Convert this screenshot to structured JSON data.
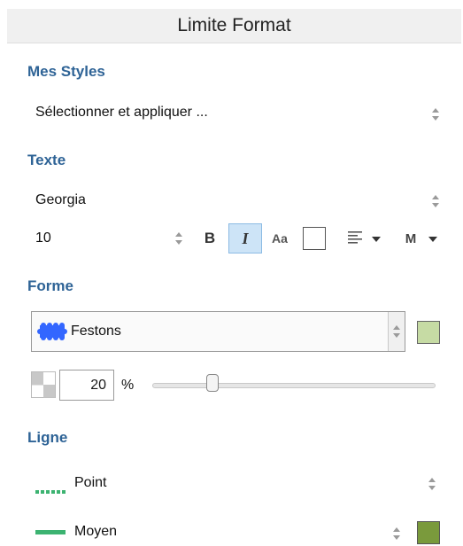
{
  "panel": {
    "title": "Limite Format"
  },
  "styles": {
    "heading": "Mes Styles",
    "select_label": "Sélectionner et appliquer ..."
  },
  "text": {
    "heading": "Texte",
    "font": "Georgia",
    "size": "10",
    "bold_label": "B",
    "italic_label": "I",
    "case_label": "Aa",
    "valign_label": "M"
  },
  "shape": {
    "heading": "Forme",
    "selected": "Festons",
    "fill_color": "#c6dba4",
    "transparency_value": "20",
    "transparency_unit": "%",
    "transparency_fraction": 0.2
  },
  "line": {
    "heading": "Ligne",
    "style": "Point",
    "weight": "Moyen",
    "style_color": "#3cb371",
    "color": "#7a9a3c"
  },
  "colors": {
    "accent": "#2e6396",
    "italic_active": "#cde4f7"
  }
}
